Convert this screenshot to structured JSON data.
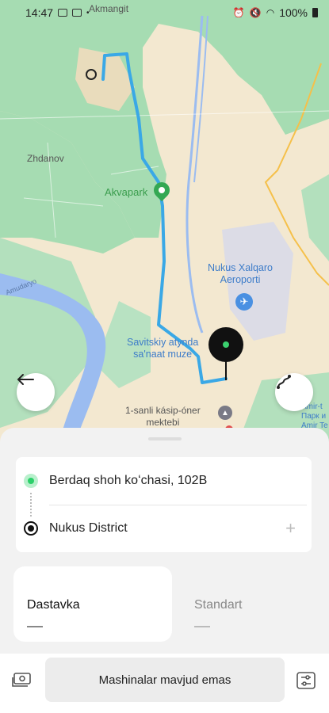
{
  "status_bar": {
    "time": "14:47",
    "battery": "100%"
  },
  "map": {
    "labels": {
      "akmangit": "Akmangit",
      "zhdanov": "Zhdanov",
      "akvapark": "Akvapark",
      "airport_line1": "Nukus Xalqaro",
      "airport_line2": "Aeroporti",
      "savitsky_line1": "Savitskiy atynda",
      "savitsky_line2": "sa'naat muze",
      "school_line1": "1-sanli kásip-óner",
      "school_line2": "mektebi",
      "amir_line1": "Amir-t",
      "amir_line2": "Парк и",
      "amir_line3": "Amir Te",
      "river": "Amudaryo"
    },
    "colors": {
      "route": "#3aa8e6",
      "park": "#a6dcb2",
      "land": "#f3e8d0",
      "water": "#9bbcf0"
    }
  },
  "route": {
    "from": "Berdaq shoh koʻchasi, 102B",
    "to": "Nukus District",
    "add_stop": "+"
  },
  "tariffs": [
    {
      "name": "Dastavka",
      "selected": true
    },
    {
      "name": "Standart",
      "selected": false
    }
  ],
  "bottom": {
    "order_button": "Mashinalar mavjud emas"
  }
}
